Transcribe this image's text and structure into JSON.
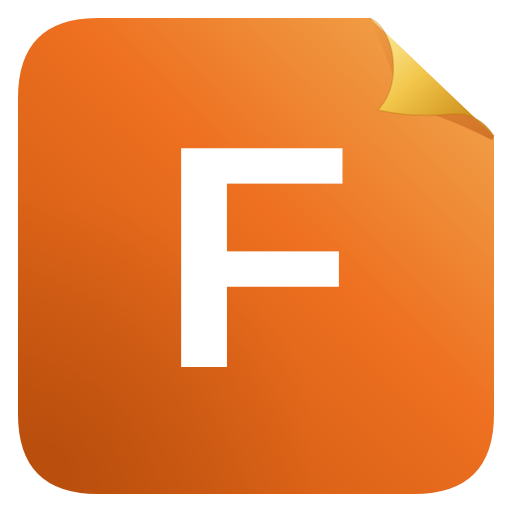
{
  "app_icon": {
    "letter": "F",
    "colors": {
      "body_light": "#F0A24A",
      "body_mid": "#EE7020",
      "body_dark": "#C9560F",
      "curl_light": "#FCE99A",
      "curl_mid": "#F2C64A",
      "curl_dark": "#C98A18",
      "letter": "#FFFFFF"
    }
  }
}
